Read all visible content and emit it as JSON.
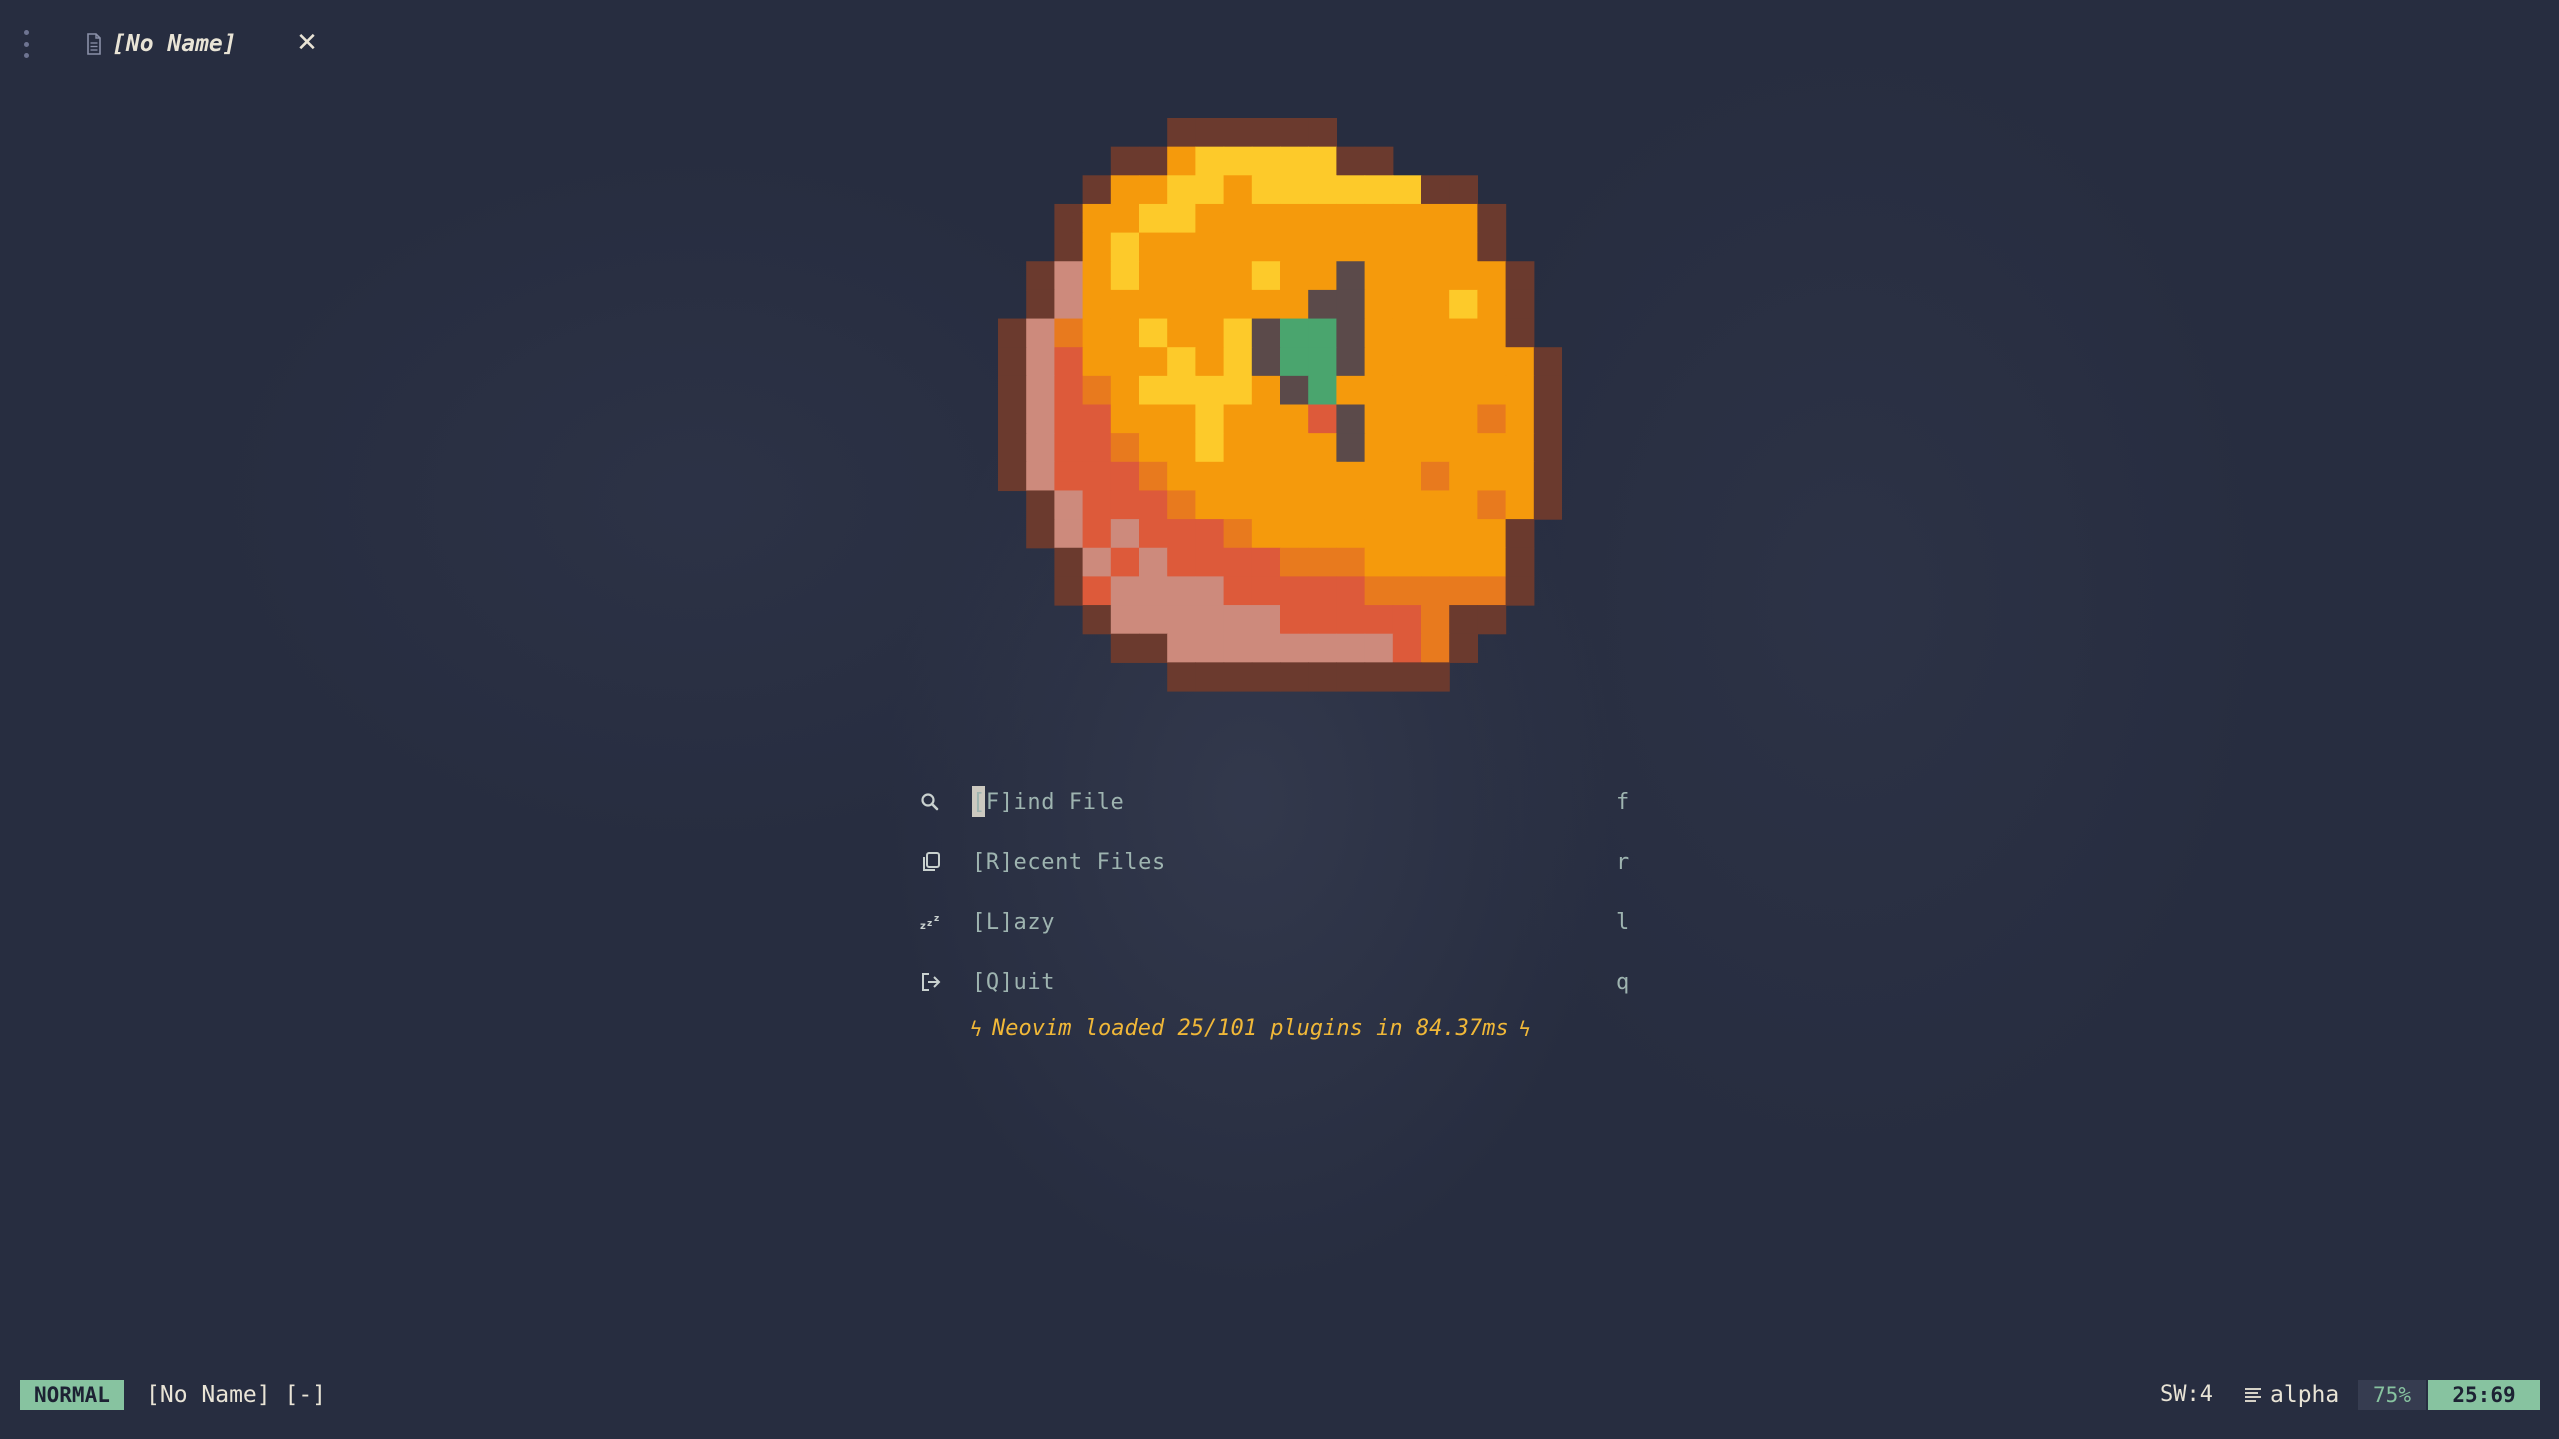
{
  "tabline": {
    "menu_icon": "vertical-dots-icon",
    "tab": {
      "icon": "file-icon",
      "title": "[No Name]"
    },
    "close_label": "✕"
  },
  "logo": {
    "description_icon": "pixel-orange-icon",
    "colors": {
      "outline": "#6b3a2e",
      "orange": "#f59a0c",
      "orange_dark": "#e87a1e",
      "highlight": "#fdca2a",
      "shadow_red": "#dd5a3a",
      "shadow_pink": "#cd8a7c",
      "stem": "#5b4a4a",
      "leaf": "#4aa56e"
    }
  },
  "dashboard": {
    "buttons": [
      {
        "icon": "search-icon",
        "label": "[F]ind File",
        "key": "f"
      },
      {
        "icon": "copy-icon",
        "label": "[R]ecent Files",
        "key": "r"
      },
      {
        "icon": "sleep-icon",
        "label": "[L]azy",
        "key": "l"
      },
      {
        "icon": "exit-icon",
        "label": "[Q]uit",
        "key": "q"
      }
    ],
    "footer": {
      "bolt": "ϟ",
      "text": "Neovim loaded 25/101 plugins in 84.37ms"
    }
  },
  "statusline": {
    "mode": "NORMAL",
    "file": "[No Name] [-]",
    "shiftwidth": "SW:4",
    "filetype_icon": "lines-icon",
    "filetype": "alpha",
    "progress": "75%",
    "position": "25:69"
  },
  "colors": {
    "background": "#272d40",
    "accent": "#87c3a0",
    "menu_text": "#9eb4b0",
    "footer_text": "#f1b838",
    "text": "#e9e4d6"
  }
}
